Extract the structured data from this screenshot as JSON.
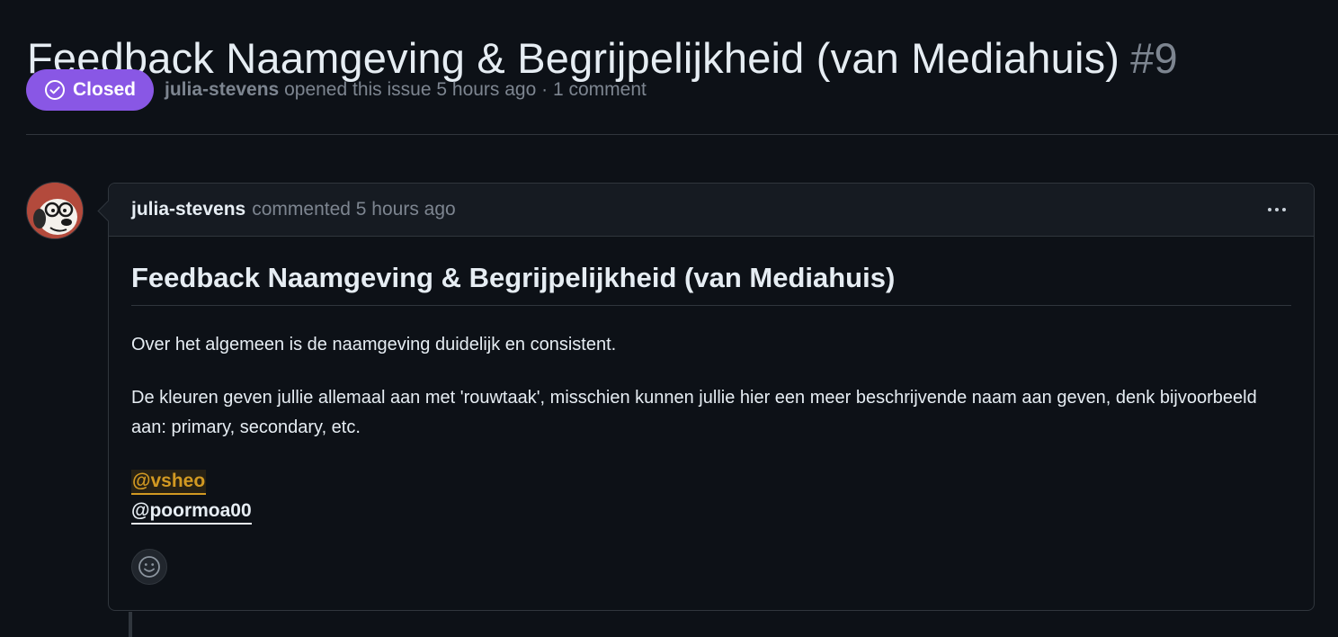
{
  "issue": {
    "title": "Feedback Naamgeving & Begrijpelijkheid (van Mediahuis)",
    "number": "#9",
    "state": "Closed",
    "state_color": "#8957e5",
    "author": "julia-stevens",
    "opened_text": "opened this issue 5 hours ago · 1 comment"
  },
  "comment": {
    "author": "julia-stevens",
    "action": "commented 5 hours ago",
    "menu_icon": "kebab-horizontal-icon",
    "heading": "Feedback Naamgeving & Begrijpelijkheid (van Mediahuis)",
    "paragraph_1": "Over het algemeen is de naamgeving duidelijk en consistent.",
    "paragraph_2": "De kleuren geven jullie allemaal aan met 'rouwtaak', misschien kunnen jullie hier een meer beschrijvende naam aan geven, denk bijvoorbeeld aan: primary, secondary, etc.",
    "mentions": [
      "@vsheo",
      "@poormoa00"
    ],
    "reaction_icon": "smiley-icon"
  },
  "colors": {
    "background": "#0d1117",
    "border": "#30363d",
    "muted_text": "#7d8590",
    "mention_highlight": "#d29922"
  }
}
